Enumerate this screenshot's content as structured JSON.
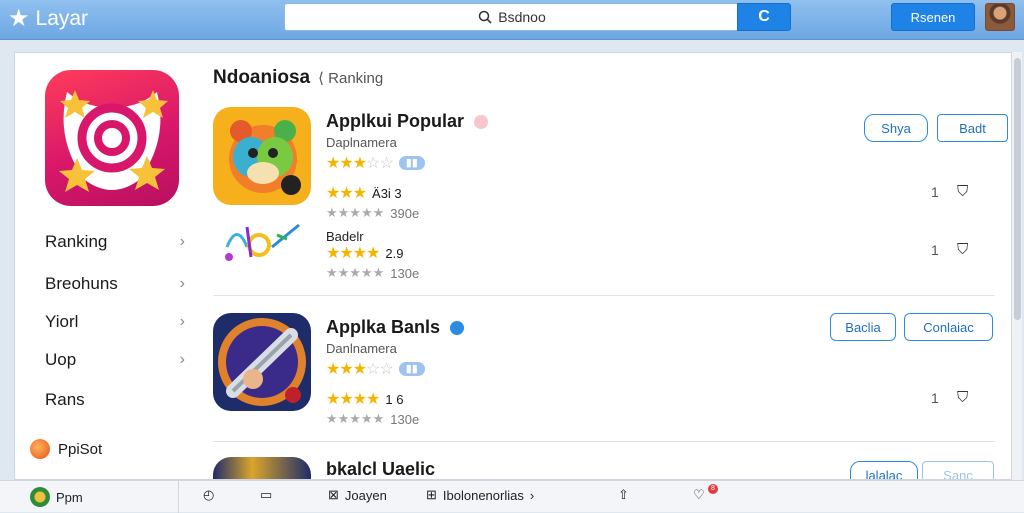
{
  "header": {
    "app_title": "Layar",
    "search_value": "Bsdnoo",
    "search_button_label": "C",
    "account_button_label": "Rsenen"
  },
  "sidebar": {
    "items": [
      {
        "label": "Ranking"
      },
      {
        "label": "Breohuns"
      },
      {
        "label": "Yiorl"
      },
      {
        "label": "Uop"
      },
      {
        "label": "Rans"
      }
    ],
    "footer_label": "PpiSot"
  },
  "content": {
    "section_title": "Ndoaniosa",
    "section_sub": "Ranking",
    "apps": [
      {
        "name": "Applkui Popular",
        "developer": "Daplnamera",
        "pill": "",
        "btn1": "Shya",
        "btn2": "Badt",
        "subs": [
          {
            "rating_text": "Ä3i 3",
            "votes": "390e",
            "count": "1"
          },
          {
            "title": "Badelr",
            "rating_text": "2.9",
            "votes": "130e",
            "count": "1"
          }
        ]
      },
      {
        "name": "Applka Banls",
        "developer": "Danlnamera",
        "btn1": "Baclia",
        "btn2": "Conlaiac",
        "subs": [
          {
            "rating_text": "1 6",
            "votes": "130e",
            "count": "1"
          }
        ]
      },
      {
        "name": "bkalcl Uaelic",
        "btn1": "lalalac",
        "btn2": "Sanc"
      }
    ]
  },
  "bottombar": {
    "item1": "Ppm",
    "item2": "Joayen",
    "item3": "Ibolonenorlias",
    "notif_count": "8"
  },
  "colors": {
    "accent": "#1e82e6",
    "topbar": "#7fb3ea",
    "star": "#f4b400"
  }
}
